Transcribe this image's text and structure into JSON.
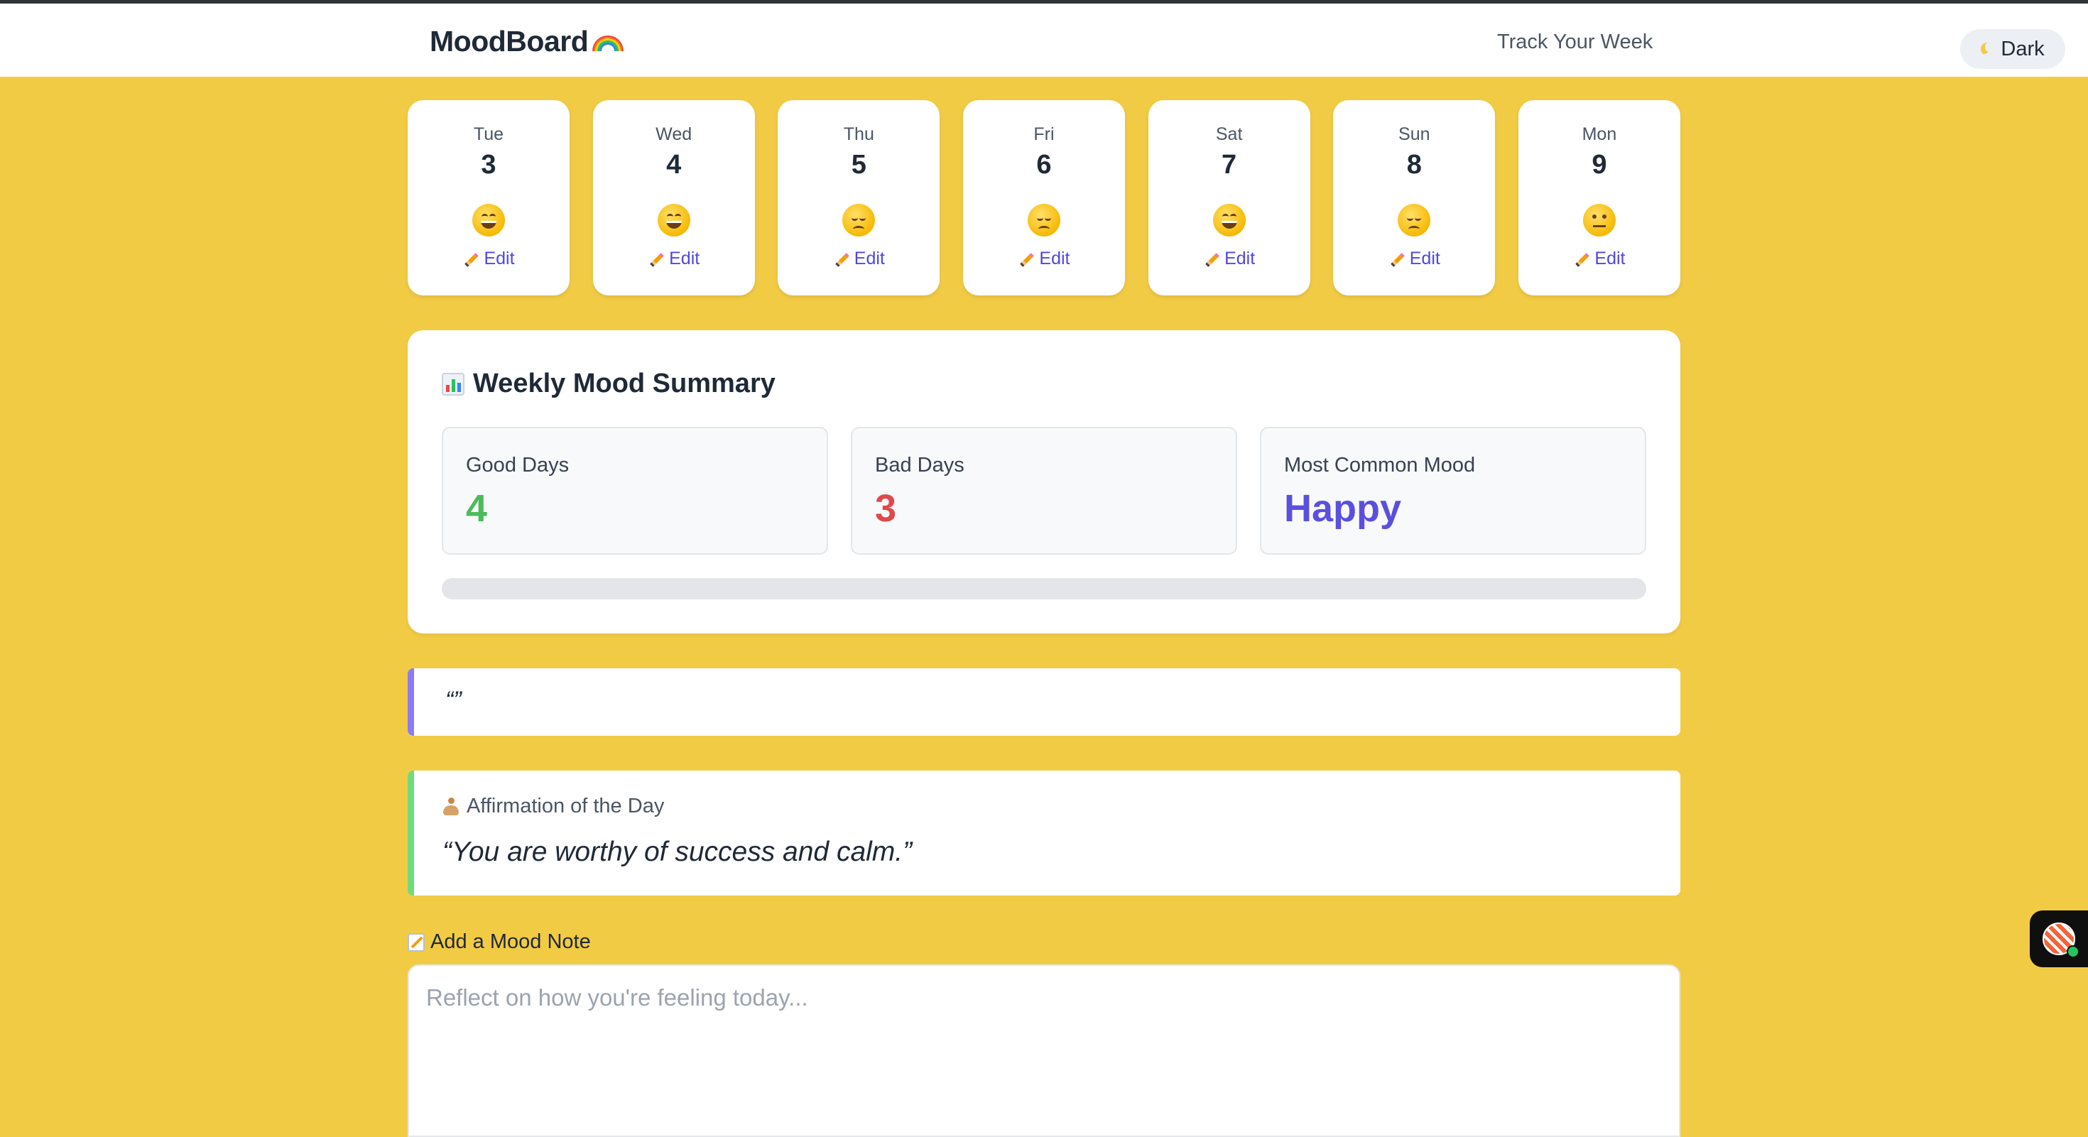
{
  "header": {
    "brand": "MoodBoard",
    "brand_icon": "rainbow-icon",
    "tagline": "Track Your Week",
    "theme_toggle_label": "Dark",
    "theme_toggle_icon": "moon-icon"
  },
  "days": [
    {
      "name": "Tue",
      "date": "3",
      "mood": "happy",
      "edit_label": "Edit"
    },
    {
      "name": "Wed",
      "date": "4",
      "mood": "happy",
      "edit_label": "Edit"
    },
    {
      "name": "Thu",
      "date": "5",
      "mood": "sad",
      "edit_label": "Edit"
    },
    {
      "name": "Fri",
      "date": "6",
      "mood": "sad",
      "edit_label": "Edit"
    },
    {
      "name": "Sat",
      "date": "7",
      "mood": "happy",
      "edit_label": "Edit"
    },
    {
      "name": "Sun",
      "date": "8",
      "mood": "sad",
      "edit_label": "Edit"
    },
    {
      "name": "Mon",
      "date": "9",
      "mood": "neutral",
      "edit_label": "Edit"
    }
  ],
  "summary": {
    "title": "Weekly Mood Summary",
    "title_icon": "bar-chart-icon",
    "good_days_label": "Good Days",
    "good_days_value": "4",
    "bad_days_label": "Bad Days",
    "bad_days_value": "3",
    "common_mood_label": "Most Common Mood",
    "common_mood_value": "Happy",
    "progress_fraction": 0
  },
  "quote": {
    "text": "“”"
  },
  "affirmation": {
    "label": "Affirmation of the Day",
    "icon": "meditation-icon",
    "text": "“You are worthy of success and calm.”"
  },
  "note": {
    "label": "Add a Mood Note",
    "icon": "memo-icon",
    "placeholder": "Reflect on how you're feeling today...",
    "value": ""
  },
  "colors": {
    "background": "#f2cb45",
    "good": "#4cbb5a",
    "bad": "#e0484a",
    "accent": "#5b4fe0",
    "quote_border": "#8b7cf6",
    "affirmation_border": "#6fdc7c"
  }
}
